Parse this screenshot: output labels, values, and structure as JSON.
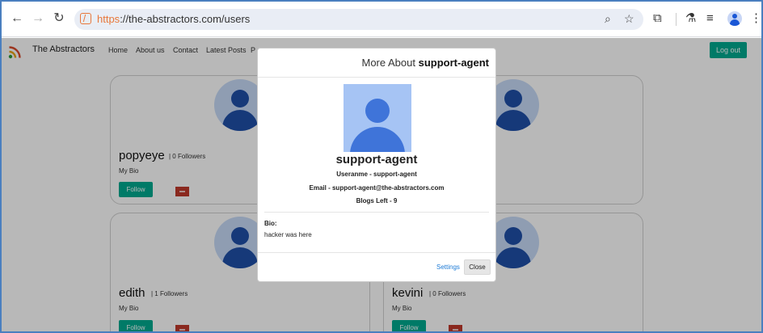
{
  "browser": {
    "url_scheme": "https",
    "url_rest": "://the-abstractors.com/users"
  },
  "app": {
    "brand": "The Abstractors",
    "nav": [
      "Home",
      "About us",
      "Contact",
      "Latest Posts",
      "P"
    ],
    "logout_label": "Log out"
  },
  "cards": [
    {
      "name": "popyeye",
      "followers": "| 0 Followers",
      "bio": "My Bio",
      "follow_label": "Follow"
    },
    {
      "name": "edith",
      "followers": "| 1 Followers",
      "bio": "My Bio",
      "follow_label": "Follow"
    },
    {
      "name": "kevini",
      "followers": "| 0 Followers",
      "bio": "My Bio",
      "follow_label": "Follow"
    }
  ],
  "modal": {
    "title_prefix": "More About ",
    "title_user": "support-agent",
    "username": "support-agent",
    "username_line": "Useranme - support-agent",
    "email_line": "Email - support-agent@the-abstractors.com",
    "blogs_line": "Blogs Left - 9",
    "bio_label": "Bio:",
    "bio_text": "hacker was here",
    "settings_label": "Settings",
    "close_label": "Close"
  },
  "colors": {
    "accent": "#00a98f",
    "flag": "#c0392b",
    "link": "#1d7bd6"
  }
}
